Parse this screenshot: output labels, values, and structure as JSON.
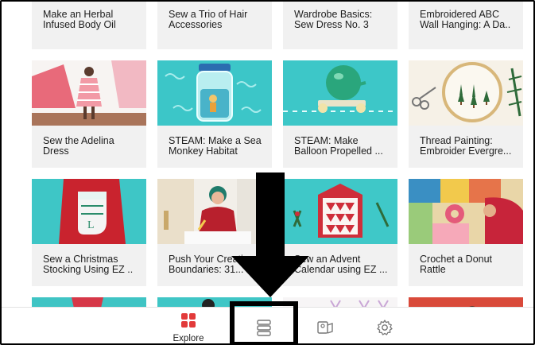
{
  "rows": [
    {
      "cards": [
        {
          "title": "Make an Herbal Infused Body Oil"
        },
        {
          "title": "Sew a Trio of Hair Accessories"
        },
        {
          "title": "Wardrobe Basics: Sew Dress No. 3"
        },
        {
          "title": "Embroidered ABC Wall Hanging: A Da.."
        }
      ]
    },
    {
      "cards": [
        {
          "title": "Sew the Adelina Dress"
        },
        {
          "title": "STEAM: Make a Sea Monkey Habitat"
        },
        {
          "title": "STEAM: Make Balloon Propelled ..."
        },
        {
          "title": "Thread Painting: Embroider Evergre..."
        }
      ]
    },
    {
      "cards": [
        {
          "title": "Sew a Christmas Stocking Using EZ .."
        },
        {
          "title": "Push Your Creative Boundaries: 31..."
        },
        {
          "title": "Sew an Advent Calendar using EZ ..."
        },
        {
          "title": "Crochet a Donut Rattle"
        }
      ]
    }
  ],
  "tabbar": {
    "tabs": [
      {
        "label": "Explore",
        "icon": "grid-icon",
        "active": true
      },
      {
        "label": "",
        "icon": "list-icon",
        "active": false
      },
      {
        "label": "",
        "icon": "projects-icon",
        "active": false
      },
      {
        "label": "",
        "icon": "gear-icon",
        "active": false
      }
    ]
  },
  "colors": {
    "accent": "#e23a3a",
    "card_bg": "#f1f1f1",
    "teal": "#38c7c7"
  }
}
